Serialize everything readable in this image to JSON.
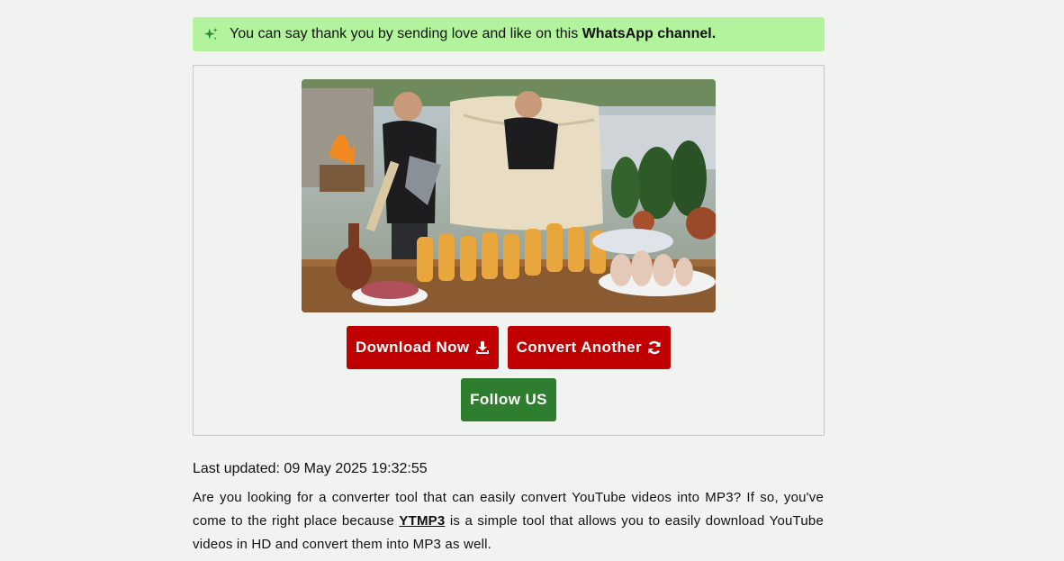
{
  "banner": {
    "text": "You can say thank you by sending love and like on this ",
    "link_text": "WhatsApp channel.",
    "icon": "sparkle-icon",
    "bg_color": "#b3f39d"
  },
  "card": {
    "thumbnail_icon": "video-thumbnail",
    "buttons": {
      "download_label": "Download Now",
      "download_icon": "download-icon",
      "convert_label": "Convert Another",
      "convert_icon": "refresh-icon",
      "follow_label": "Follow US"
    },
    "colors": {
      "red": "#c00000",
      "green": "#2f7d2f"
    }
  },
  "article": {
    "updated": "Last updated: 09 May 2025 19:32:55",
    "para_before": "Are you looking for a converter tool that can easily convert YouTube videos into MP3? If so, you've come to the right place because ",
    "link": "YTMP3",
    "para_after": " is a simple tool that allows you to easily download YouTube videos in HD and convert them into MP3 as well."
  }
}
